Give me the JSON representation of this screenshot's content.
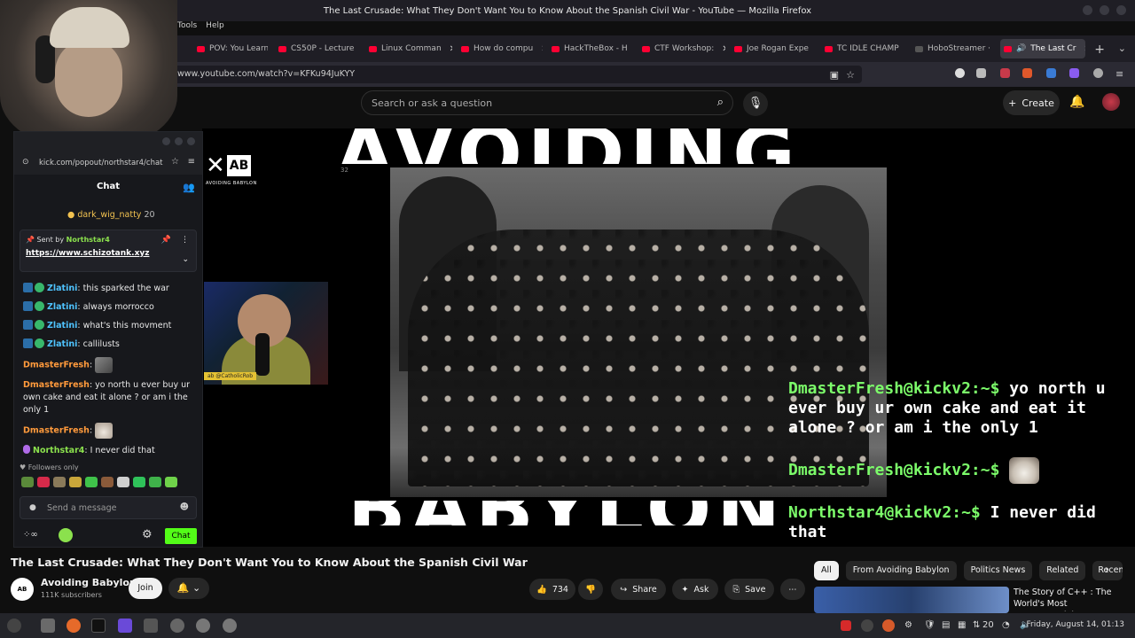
{
  "window_title": "The Last Crusade: What They Don't Want You to Know About the Spanish Civil War - YouTube — Mozilla Firefox",
  "menu": [
    "Tools",
    "Help"
  ],
  "tabs": [
    {
      "label": "POV: You Learn"
    },
    {
      "label": "CS50P - Lecture"
    },
    {
      "label": "Linux Comman"
    },
    {
      "label": "How do compu"
    },
    {
      "label": "HackTheBox - H"
    },
    {
      "label": "CTF Workshop:"
    },
    {
      "label": "Joe Rogan Expe"
    },
    {
      "label": "TC IDLE CHAMP"
    },
    {
      "label": "HoboStreamer ·"
    },
    {
      "label": "The Last Cr"
    }
  ],
  "url": "www.youtube.com/watch?v=KFKu94JuKYY",
  "youtube": {
    "search_placeholder": "Search or ask a question",
    "create_label": "Create"
  },
  "kick_popup": {
    "url": "kick.com/popout/northstar4/chat",
    "chat_title": "Chat",
    "gifter": "dark_wig_natty",
    "gift_count": "20",
    "pinned_sent_by": "Sent by",
    "pinned_user": "Northstar4",
    "pinned_link": "https://www.schizotank.xyz",
    "messages": [
      {
        "user": "Zlatini",
        "text": ": this sparked the war"
      },
      {
        "user": "Zlatini",
        "text": ": always morrocco"
      },
      {
        "user": "Zlatini",
        "text": ": what's this movment"
      },
      {
        "user": "Zlatini",
        "text": ": callilusts"
      },
      {
        "user": "DmasterFresh",
        "text": ":"
      },
      {
        "user": "DmasterFresh",
        "text": ": yo north u ever buy ur own cake and eat it alone ? or am i the only 1"
      },
      {
        "user": "DmasterFresh",
        "text": ":"
      },
      {
        "user": "Northstar4",
        "text": ": I never did that"
      }
    ],
    "followers_only": "Followers only",
    "input_placeholder": "Send a message",
    "chat_button": "Chat"
  },
  "video": {
    "overlay_top": "AVOIDING",
    "overlay_bottom": "BABYLON",
    "logo_sub": "AVOIDING BABYLON",
    "small_num": "32",
    "cam_tag": "ab @CatholicRob",
    "term_lines": [
      {
        "user": "DmasterFresh@kickv2:~$",
        "text": " yo north u ever buy ur own cake and eat it alone ? or am i the only 1"
      },
      {
        "user": "DmasterFresh@kickv2:~$",
        "text": ""
      },
      {
        "user": "Northstar4@kickv2:~$",
        "text": " I never did that"
      }
    ]
  },
  "below": {
    "title": "The Last Crusade: What They Don't Want You to Know About the Spanish Civil War",
    "channel": "Avoiding Babylon",
    "avatar_text": "AB",
    "subs": "111K subscribers",
    "join": "Join",
    "likes": "734",
    "share": "Share",
    "ask": "Ask",
    "save": "Save",
    "chips": [
      "All",
      "From Avoiding Babylon",
      "Politics News",
      "Related",
      "Recent"
    ],
    "rec_title": "The Story of C++ : The World's Most Consequential Programming Language"
  },
  "taskbar": {
    "tray_text": "20",
    "clock": "Friday, August 14, 01:13"
  }
}
